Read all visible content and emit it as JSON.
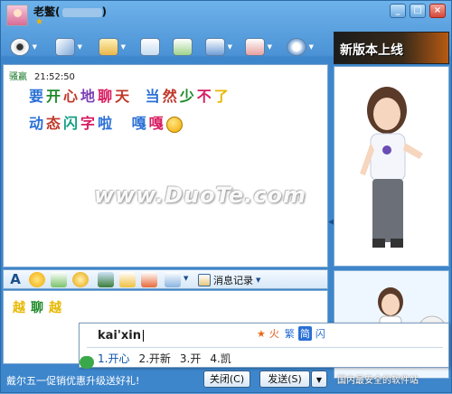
{
  "window": {
    "contact_name": "老鳖(",
    "contact_name_suffix": ")",
    "status_symbol": "★",
    "controls": {
      "minimize": "_",
      "maximize": "□",
      "close": "×"
    }
  },
  "toolbar": {
    "items": [
      {
        "name": "video-icon",
        "has_dropdown": true
      },
      {
        "name": "mic-icon",
        "has_dropdown": true
      },
      {
        "name": "folder-icon",
        "has_dropdown": true
      },
      {
        "name": "mail-icon",
        "has_dropdown": false
      },
      {
        "name": "notes-icon",
        "has_dropdown": false
      },
      {
        "name": "group-icon",
        "has_dropdown": true
      },
      {
        "name": "game-icon",
        "has_dropdown": true
      },
      {
        "name": "settings-icon",
        "has_dropdown": true
      }
    ]
  },
  "banner": {
    "text": "新版本上线"
  },
  "chat": {
    "sender": "骚赢",
    "time": "21:52:50",
    "line1": [
      "要",
      "开",
      "心",
      "地",
      "聊",
      "天",
      "当",
      "然",
      "少",
      "不",
      "了"
    ],
    "line2": [
      "动",
      "态",
      "闪",
      "字",
      "啦",
      "嘎",
      "嘎"
    ],
    "emoticon": "grin-emoticon"
  },
  "watermark": "www.DuoTe.com",
  "format_bar": {
    "message_record_label": "消息记录"
  },
  "input": {
    "chars": [
      "越",
      "聊",
      "越"
    ]
  },
  "ime": {
    "composition": "kai'xin",
    "candidates": [
      "1.开心",
      "2.开新",
      "3.开",
      "4.凯"
    ],
    "status": [
      "火",
      "繁",
      "简",
      "闪"
    ]
  },
  "bottom": {
    "promo_text": "戴尔五一促销优惠升级送好礼!",
    "close_label": "关闭(C)",
    "send_label": "发送(S)",
    "footer_site": "国内最安全的软件站"
  },
  "colors": {
    "window_blue": "#4b93d6",
    "panel_border": "#7ea7cf"
  }
}
